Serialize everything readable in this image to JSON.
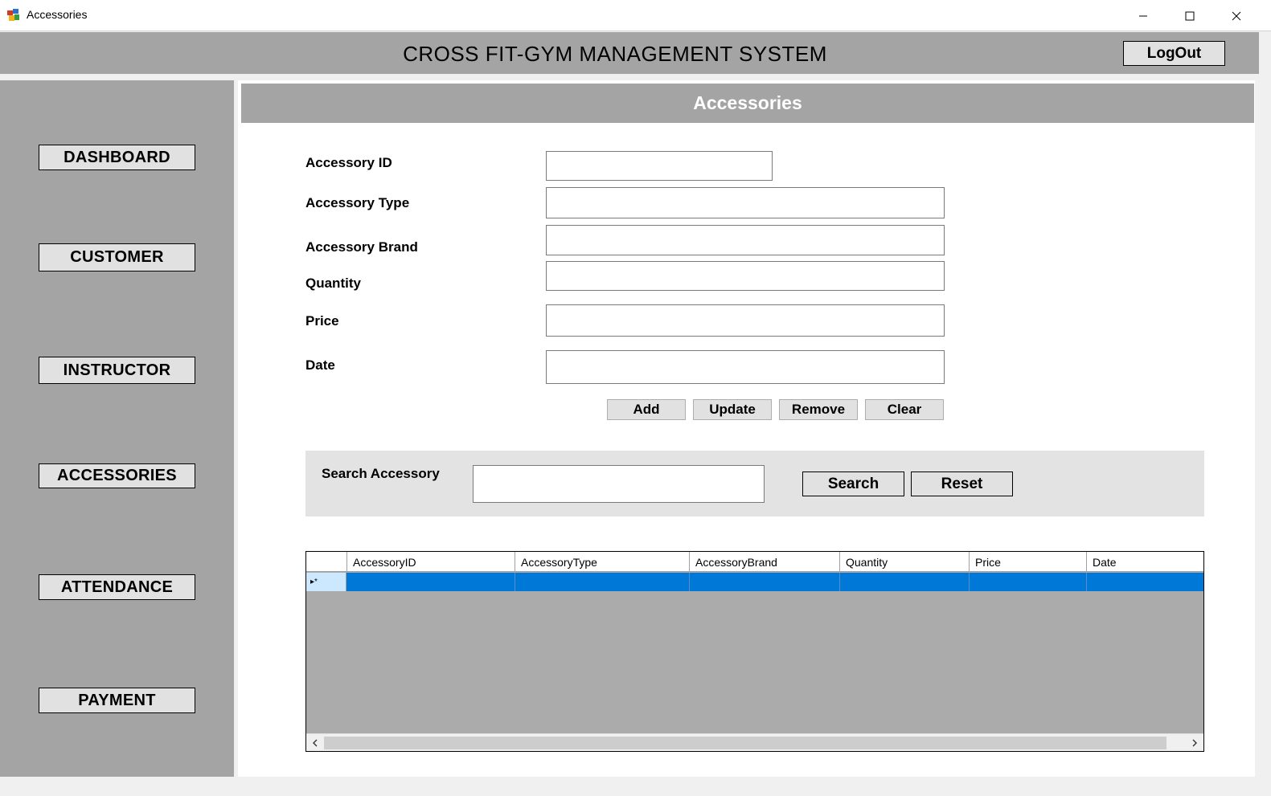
{
  "window": {
    "title": "Accessories",
    "icons": [
      "app-icon",
      "minimize-icon",
      "maximize-icon",
      "close-icon"
    ]
  },
  "header": {
    "app_title": "CROSS FIT-GYM MANAGEMENT SYSTEM",
    "logout_label": "LogOut"
  },
  "sidebar": {
    "items": [
      {
        "label": "DASHBOARD"
      },
      {
        "label": "CUSTOMER"
      },
      {
        "label": "INSTRUCTOR"
      },
      {
        "label": "ACCESSORIES"
      },
      {
        "label": "ATTENDANCE"
      },
      {
        "label": "PAYMENT"
      }
    ]
  },
  "page": {
    "heading": "Accessories"
  },
  "form": {
    "fields": [
      {
        "label": "Accessory ID",
        "value": ""
      },
      {
        "label": "Accessory Type",
        "value": ""
      },
      {
        "label": "Accessory Brand",
        "value": ""
      },
      {
        "label": "Quantity",
        "value": ""
      },
      {
        "label": "Price",
        "value": ""
      },
      {
        "label": "Date",
        "value": ""
      }
    ],
    "buttons": {
      "add": "Add",
      "update": "Update",
      "remove": "Remove",
      "clear": "Clear"
    }
  },
  "search": {
    "label": "Search Accessory",
    "value": "",
    "search_button": "Search",
    "reset_button": "Reset"
  },
  "grid": {
    "columns": [
      "AccessoryID",
      "AccessoryType",
      "AccessoryBrand",
      "Quantity",
      "Price",
      "Date"
    ],
    "new_row_marker": "▸*",
    "rows": []
  },
  "colors": {
    "panel_gray": "#a4a4a4",
    "selection_blue": "#0078d7",
    "row_header_blue": "#cce8ff"
  }
}
